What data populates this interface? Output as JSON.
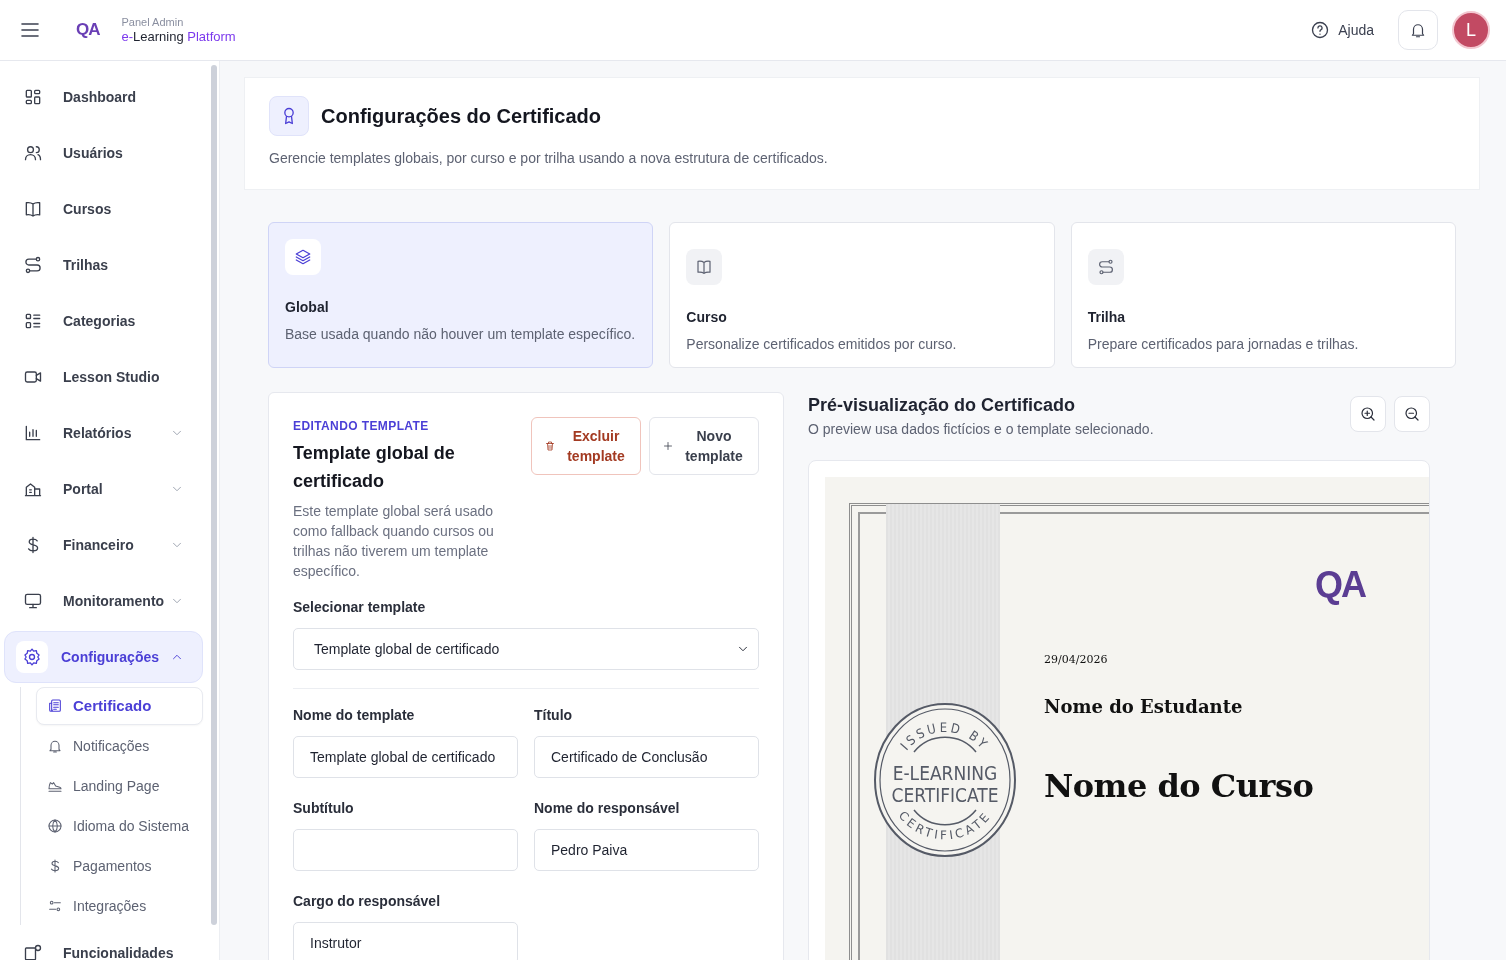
{
  "header": {
    "logo": "QA",
    "kicker": "Panel Admin",
    "brand_parts": [
      {
        "text": "e-",
        "accent": true
      },
      {
        "text": "Learning",
        "accent": false
      },
      {
        "text": " Platform",
        "accent": true
      }
    ],
    "help": "Ajuda",
    "avatar": "L"
  },
  "sidebar": {
    "items": [
      {
        "label": "Dashboard",
        "selected": false
      },
      {
        "label": "Usuários",
        "selected": false
      },
      {
        "label": "Cursos",
        "selected": false
      },
      {
        "label": "Trilhas",
        "selected": false
      },
      {
        "label": "Categorias",
        "selected": false
      },
      {
        "label": "Lesson Studio",
        "selected": false
      },
      {
        "label": "Relatórios",
        "expanded": false,
        "selected": false
      },
      {
        "label": "Portal",
        "expanded": false,
        "selected": false
      },
      {
        "label": "Financeiro",
        "expanded": false,
        "selected": false
      },
      {
        "label": "Monitoramento",
        "expanded": false,
        "selected": false
      },
      {
        "label": "Configurações",
        "expanded": true,
        "selected": true,
        "children": [
          {
            "label": "Certificado",
            "selected": true
          },
          {
            "label": "Notificações",
            "selected": false
          },
          {
            "label": "Landing Page",
            "selected": false
          },
          {
            "label": "Idioma do Sistema",
            "selected": false
          },
          {
            "label": "Pagamentos",
            "selected": false
          },
          {
            "label": "Integrações",
            "selected": false
          }
        ]
      },
      {
        "label": "Funcionalidades",
        "selected": false
      }
    ]
  },
  "page": {
    "title": "Configurações do Certificado",
    "description": "Gerencie templates globais, por curso e por trilha usando a nova estrutura de certificados."
  },
  "scopes": [
    {
      "title": "Global",
      "description": "Base usada quando não houver um template específico.",
      "selected": true
    },
    {
      "title": "Curso",
      "description": "Personalize certificados emitidos por curso.",
      "selected": false
    },
    {
      "title": "Trilha",
      "description": "Prepare certificados para jornadas e trilhas.",
      "selected": false
    }
  ],
  "editor": {
    "eyebrow": "EDITANDO TEMPLATE",
    "title": "Template global de certificado",
    "description": "Este template global será usado como fallback quando cursos ou trilhas não tiverem um template específico.",
    "buttons": [
      {
        "label": "Excluir template",
        "kind": "danger"
      },
      {
        "label": "Novo template",
        "kind": "add"
      }
    ],
    "select": {
      "label": "Selecionar template",
      "value": "Template global de certificado"
    },
    "fields": [
      {
        "label": "Nome do template",
        "value": "Template global de certificado"
      },
      {
        "label": "Título",
        "value": "Certificado de Conclusão"
      },
      {
        "label": "Subtítulo"
      },
      {
        "label": "Nome do responsável",
        "value": "Pedro Paiva"
      },
      {
        "label": "Cargo do responsável",
        "value": "Instrutor"
      }
    ]
  },
  "preview": {
    "title": "Pré-visualização do Certificado",
    "description": "O preview usa dados fictícios e o template selecionado.",
    "certificate": {
      "logo": "QA",
      "date": "29/04/2026",
      "student": "Nome do Estudante",
      "course": "Nome do Curso",
      "seal_top": "ISSUED BY",
      "seal_line_1": "E-LEARNING",
      "seal_line_2": "CERTIFICATE",
      "seal_bottom": "CERTIFICATE"
    }
  }
}
